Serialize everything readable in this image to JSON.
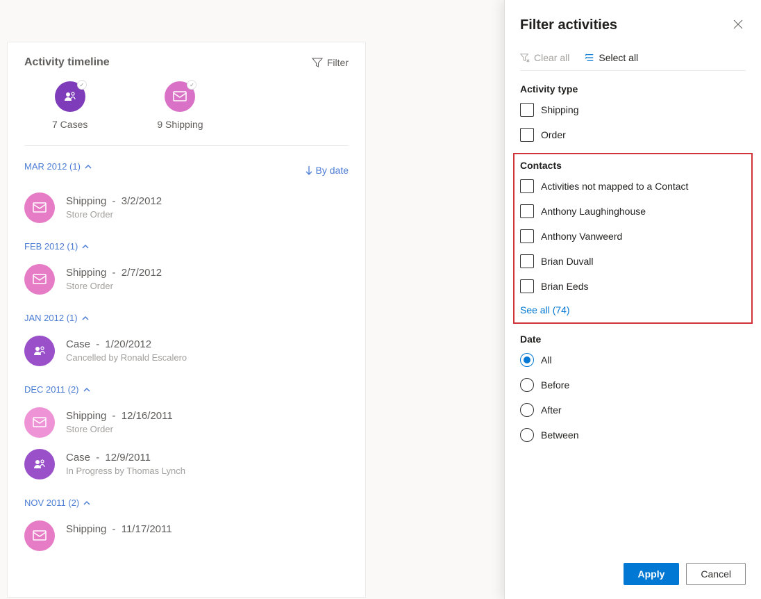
{
  "timeline": {
    "title": "Activity timeline",
    "filter_label": "Filter",
    "summary": [
      {
        "label": "7 Cases",
        "color": "purple",
        "icon": "person"
      },
      {
        "label": "9 Shipping",
        "color": "pink",
        "icon": "mail"
      }
    ],
    "sort_label": "By date",
    "groups": [
      {
        "header": "MAR 2012 (1)",
        "items": [
          {
            "type": "Shipping",
            "date": "3/2/2012",
            "sub": "Store Order",
            "icon": "mail",
            "color": "pink"
          }
        ]
      },
      {
        "header": "FEB 2012 (1)",
        "items": [
          {
            "type": "Shipping",
            "date": "2/7/2012",
            "sub": "Store Order",
            "icon": "mail",
            "color": "pink"
          }
        ]
      },
      {
        "header": "JAN 2012 (1)",
        "items": [
          {
            "type": "Case",
            "date": "1/20/2012",
            "sub": "Cancelled by Ronald Escalero",
            "icon": "person",
            "color": "purple"
          }
        ]
      },
      {
        "header": "DEC 2011 (2)",
        "items": [
          {
            "type": "Shipping",
            "date": "12/16/2011",
            "sub": "Store Order",
            "icon": "mail",
            "color": "pink-light"
          },
          {
            "type": "Case",
            "date": "12/9/2011",
            "sub": "In Progress by Thomas Lynch",
            "icon": "person",
            "color": "purple"
          }
        ]
      },
      {
        "header": "NOV 2011 (2)",
        "items": [
          {
            "type": "Shipping",
            "date": "11/17/2011",
            "sub": "",
            "icon": "mail",
            "color": "pink"
          }
        ]
      }
    ]
  },
  "filterPanel": {
    "title": "Filter activities",
    "clear_all": "Clear all",
    "select_all": "Select all",
    "activity_type": {
      "heading": "Activity type",
      "options": [
        "Shipping",
        "Order"
      ]
    },
    "contacts": {
      "heading": "Contacts",
      "options": [
        "Activities not mapped to a Contact",
        "Anthony Laughinghouse",
        "Anthony Vanweerd",
        "Brian Duvall",
        "Brian Eeds"
      ],
      "see_all": "See all (74)"
    },
    "date": {
      "heading": "Date",
      "options": [
        "All",
        "Before",
        "After",
        "Between"
      ],
      "selected": "All"
    },
    "apply": "Apply",
    "cancel": "Cancel"
  }
}
